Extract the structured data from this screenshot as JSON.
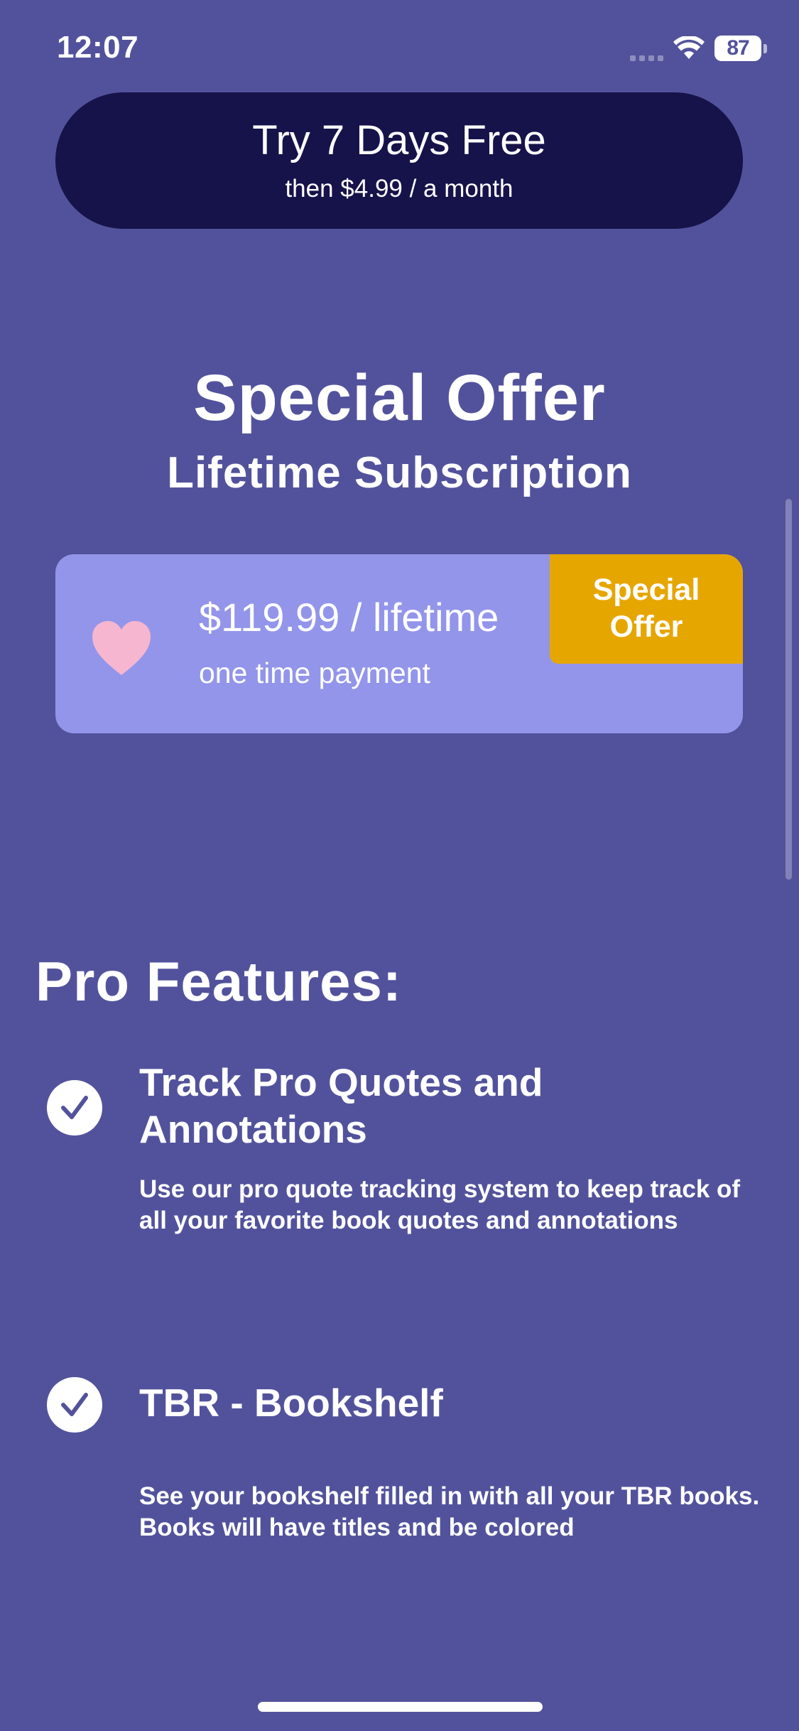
{
  "status_bar": {
    "time": "12:07",
    "battery_level": "87",
    "icons": [
      "signal-icon",
      "wifi-icon",
      "battery-icon"
    ]
  },
  "trial": {
    "title": "Try 7 Days Free",
    "subtitle": "then $4.99 / a month"
  },
  "offer": {
    "title": "Special Offer",
    "subtitle": "Lifetime Subscription"
  },
  "lifetime_plan": {
    "icon": "heart-icon",
    "price": "$119.99 / lifetime",
    "note": "one time payment",
    "badge": "Special Offer"
  },
  "features": {
    "heading": "Pro Features:",
    "items": [
      {
        "icon": "checkmark-circle-icon",
        "title": "Track Pro Quotes and Annotations",
        "description": "Use our pro quote tracking system to keep track of all your favorite book quotes and annotations"
      },
      {
        "icon": "checkmark-circle-icon",
        "title": "TBR - Bookshelf",
        "description": "See your bookshelf filled in with all your TBR books. Books will have titles and be colored"
      }
    ]
  },
  "colors": {
    "background": "#52529c",
    "trial_button": "#16134a",
    "plan_card": "#9395ea",
    "badge": "#e6a600",
    "heart": "#f7b6cf"
  }
}
